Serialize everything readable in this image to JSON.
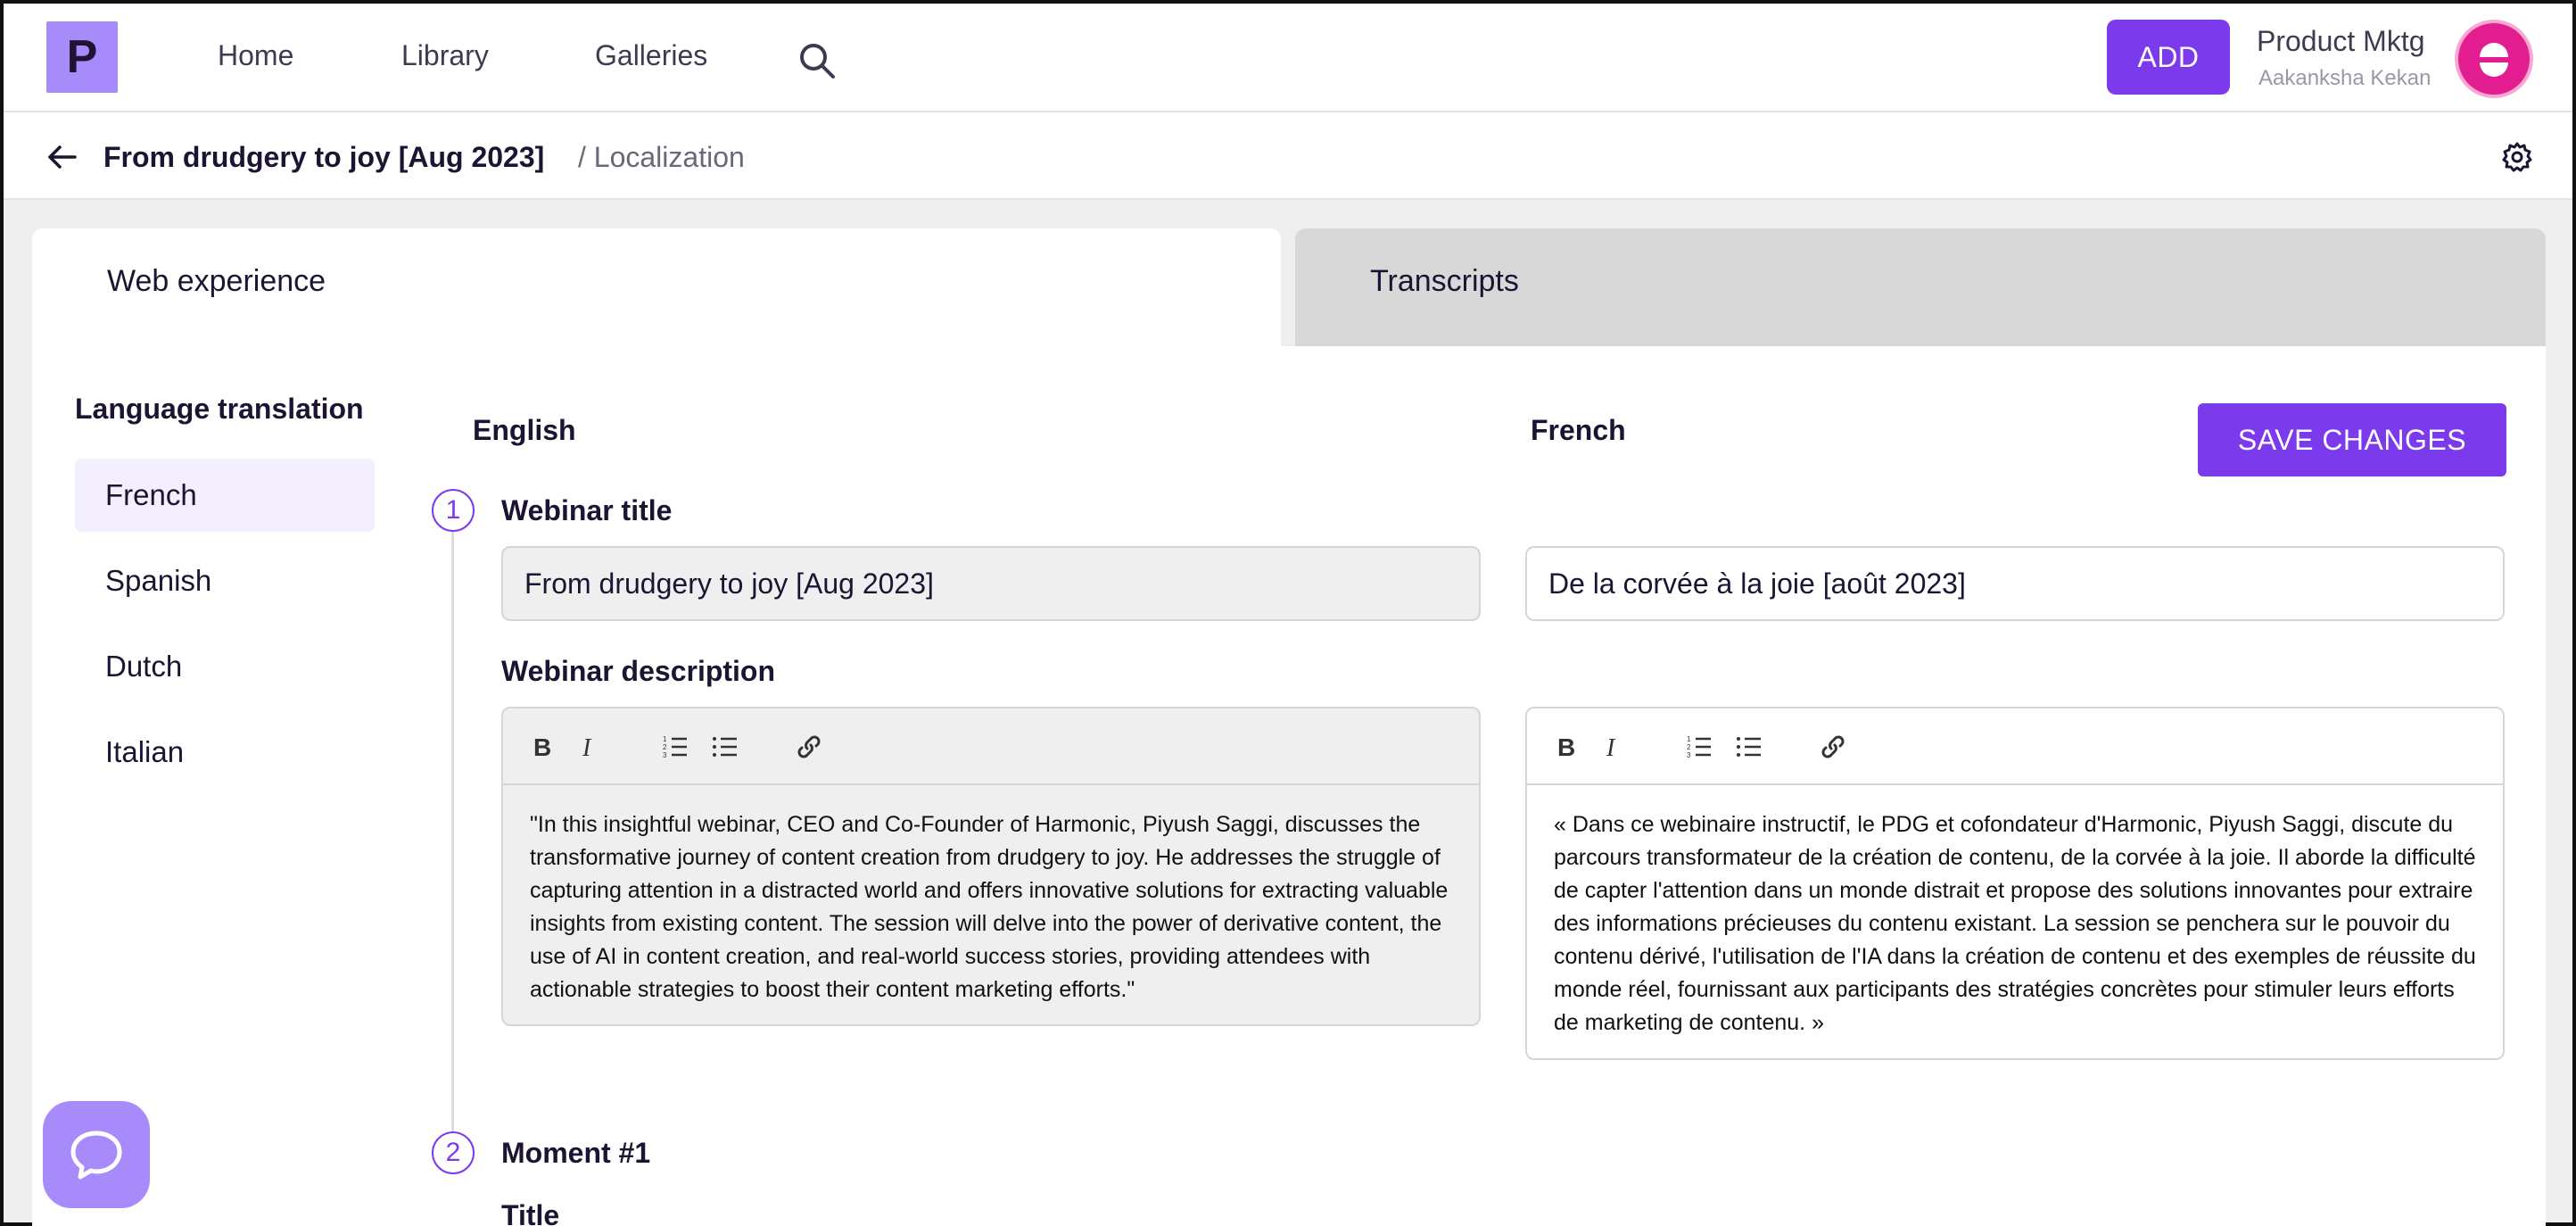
{
  "nav": {
    "logo_letter": "P",
    "links": [
      "Home",
      "Library",
      "Galleries"
    ],
    "add_label": "ADD",
    "workspace": "Product Mktg",
    "user": "Aakanksha Kekan"
  },
  "breadcrumb": {
    "title": "From drudgery to joy [Aug 2023]",
    "section": "/ Localization"
  },
  "tabs": [
    "Web experience",
    "Transcripts"
  ],
  "sidebar": {
    "heading": "Language translation",
    "languages": [
      "French",
      "Spanish",
      "Dutch",
      "Italian"
    ],
    "selected": "French"
  },
  "columns": {
    "source": "English",
    "target": "French",
    "save_label": "SAVE CHANGES"
  },
  "steps": [
    {
      "number": "1",
      "label": "Webinar title"
    },
    {
      "number": "2",
      "label": "Moment #1"
    }
  ],
  "fields": {
    "title_label": "Webinar title",
    "title_en": "From drudgery to joy [Aug 2023]",
    "title_fr": "De la corvée à la joie [août 2023]",
    "description_label": "Webinar description",
    "description_en": "\"In this insightful webinar, CEO and Co-Founder of Harmonic, Piyush Saggi, discusses the transformative journey of content creation from drudgery to joy. He addresses the struggle of capturing attention in a distracted world and offers innovative solutions for extracting valuable insights from existing content. The session will delve into the power of derivative content, the use of AI in content creation, and real-world success stories, providing attendees with actionable strategies to boost their content marketing efforts.\"",
    "description_fr": "« Dans ce webinaire instructif, le PDG et cofondateur d'Harmonic, Piyush Saggi, discute du parcours transformateur de la création de contenu, de la corvée à la joie. Il aborde la difficulté de capter l'attention dans un monde distrait et propose des solutions innovantes pour extraire des informations précieuses du contenu existant. La session se penchera sur le pouvoir du contenu dérivé, l'utilisation de l'IA dans la création de contenu et des exemples de réussite du monde réel, fournissant aux participants des stratégies concrètes pour stimuler leurs efforts de marketing de contenu. »",
    "moment_title_label": "Title"
  },
  "icons": {
    "search": "search-icon",
    "back": "arrow-left-icon",
    "settings": "gear-icon",
    "chat": "chat-bubble-icon"
  },
  "colors": {
    "accent": "#7c3aed",
    "logo_bg": "#a78bfa",
    "avatar": "#e11d8f"
  }
}
